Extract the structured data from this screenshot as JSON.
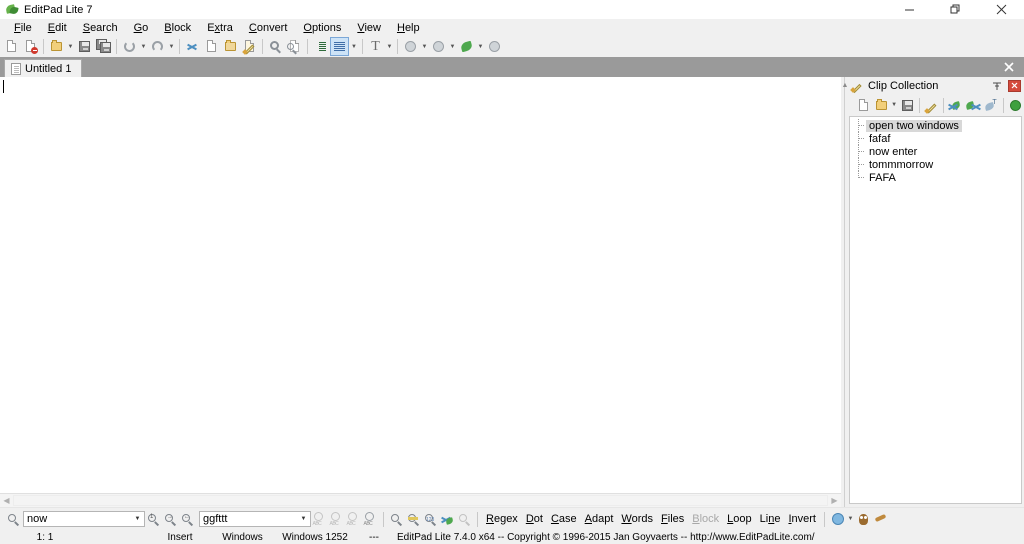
{
  "window": {
    "title": "EditPad Lite 7",
    "app_icon": "leaf-icon",
    "controls": {
      "minimize": "–",
      "restore": "❐",
      "close": "✕"
    }
  },
  "menu": {
    "items": [
      {
        "label": "File",
        "accel": "F"
      },
      {
        "label": "Edit",
        "accel": "E"
      },
      {
        "label": "Search",
        "accel": "S"
      },
      {
        "label": "Go",
        "accel": "G"
      },
      {
        "label": "Block",
        "accel": "B"
      },
      {
        "label": "Extra",
        "accel": "x"
      },
      {
        "label": "Convert",
        "accel": "C"
      },
      {
        "label": "Options",
        "accel": "O"
      },
      {
        "label": "View",
        "accel": "V"
      },
      {
        "label": "Help",
        "accel": "H"
      }
    ]
  },
  "toolbar": {
    "buttons": [
      {
        "name": "new-file-icon",
        "title": "New"
      },
      {
        "name": "close-file-icon",
        "title": "Close"
      },
      {
        "name": "open-file-icon",
        "title": "Open"
      },
      {
        "name": "save-file-icon",
        "title": "Save"
      },
      {
        "name": "save-all-icon",
        "title": "Save All"
      },
      {
        "name": "undo-icon",
        "title": "Undo"
      },
      {
        "name": "redo-icon",
        "title": "Redo"
      },
      {
        "name": "cut-icon",
        "title": "Cut"
      },
      {
        "name": "copy-icon",
        "title": "Copy"
      },
      {
        "name": "paste-icon",
        "title": "Paste"
      },
      {
        "name": "edit-clip-icon",
        "title": "Edit Clip"
      },
      {
        "name": "find-icon",
        "title": "Find"
      },
      {
        "name": "find-replace-icon",
        "title": "Replace"
      },
      {
        "name": "indent-icon",
        "title": "Indent"
      },
      {
        "name": "word-wrap-icon",
        "title": "Word Wrap"
      },
      {
        "name": "font-icon",
        "title": "Font"
      },
      {
        "name": "back-icon",
        "title": "Back"
      },
      {
        "name": "forward-icon",
        "title": "Forward"
      },
      {
        "name": "leaf-icon",
        "title": "Clip Collection"
      },
      {
        "name": "globe-icon",
        "title": "Browse"
      }
    ]
  },
  "tabs": {
    "items": [
      {
        "label": "Untitled 1",
        "icon": "document-icon",
        "active": true
      }
    ],
    "close_label": "✕"
  },
  "editor": {
    "content": "",
    "caret_visible": true
  },
  "clip_panel": {
    "title": "Clip Collection",
    "icon": "clip-pencil-icon",
    "pin_label": "⚲",
    "close_label": "✕",
    "toolbar": [
      {
        "name": "new-clip-icon",
        "title": "New Clip"
      },
      {
        "name": "open-collection-icon",
        "title": "Open Collection"
      },
      {
        "name": "save-collection-icon",
        "title": "Save Collection"
      },
      {
        "name": "edit-clip-icon",
        "title": "Edit Clip"
      },
      {
        "name": "cut-clip-icon",
        "title": "Cut Clip"
      },
      {
        "name": "paste-clip-icon",
        "title": "Paste Clip"
      },
      {
        "name": "insert-clip-icon",
        "title": "Insert Clip"
      },
      {
        "name": "globe-green-icon",
        "title": "Go"
      }
    ],
    "items": [
      {
        "label": "open two windows",
        "selected": true
      },
      {
        "label": "fafaf",
        "selected": false
      },
      {
        "label": "now enter",
        "selected": false
      },
      {
        "label": "tommmorrow",
        "selected": false
      },
      {
        "label": "FAFA",
        "selected": false
      }
    ]
  },
  "search_bar": {
    "search_icon": "search-icon",
    "find_value": "now",
    "find_placeholder": "",
    "replace_value": "ggfttt",
    "replace_placeholder": "",
    "dropdown_glyph": "▼",
    "find_buttons": [
      {
        "name": "find-first-icon",
        "title": "Find First"
      },
      {
        "name": "find-next-icon",
        "title": "Find Next"
      },
      {
        "name": "find-previous-icon",
        "title": "Find Previous"
      }
    ],
    "replace_buttons": [
      {
        "name": "replace-first-icon",
        "title": "Replace First"
      },
      {
        "name": "replace-next-icon",
        "title": "Replace Next"
      },
      {
        "name": "replace-previous-icon",
        "title": "Replace Previous"
      },
      {
        "name": "replace-all-icon",
        "title": "Replace All"
      }
    ],
    "count_buttons": [
      {
        "name": "count-matches-icon",
        "title": "Count Matches"
      },
      {
        "name": "highlight-matches-icon",
        "title": "Highlight Matches"
      },
      {
        "name": "number-matches-icon",
        "title": "Number Matches"
      },
      {
        "name": "cut-matches-icon",
        "title": "Cut Matches"
      },
      {
        "name": "select-matches-icon",
        "title": "Select Matches"
      }
    ],
    "options": [
      {
        "label": "Regex",
        "accel": "R",
        "enabled": true
      },
      {
        "label": "Dot",
        "accel": "D",
        "enabled": true
      },
      {
        "label": "Case",
        "accel": "C",
        "enabled": true
      },
      {
        "label": "Adapt",
        "accel": "A",
        "enabled": true
      },
      {
        "label": "Words",
        "accel": "W",
        "enabled": true
      },
      {
        "label": "Files",
        "accel": "F",
        "enabled": true
      },
      {
        "label": "Block",
        "accel": "B",
        "enabled": false
      },
      {
        "label": "Loop",
        "accel": "L",
        "enabled": true
      },
      {
        "label": "Line",
        "accel": "n",
        "enabled": true
      },
      {
        "label": "Invert",
        "accel": "I",
        "enabled": true
      }
    ],
    "trailing_buttons": [
      {
        "name": "search-web-icon",
        "title": "Search Web"
      },
      {
        "name": "owl-icon",
        "title": "RegexBuddy"
      },
      {
        "name": "magic-wand-icon",
        "title": "RegexMagic"
      }
    ]
  },
  "status_bar": {
    "cursor_position": "1: 1",
    "selection": "",
    "insert_mode": "Insert",
    "line_break": "Windows",
    "encoding": "Windows 1252",
    "separator": "---",
    "copyright": "EditPad Lite 7.4.0 x64  --  Copyright © 1996-2015  Jan Goyvaerts  --  http://www.EditPadLite.com/"
  },
  "colors": {
    "window_bg": "#f0f0f0",
    "tabbar_bg": "#9a9a9a",
    "editor_bg": "#ffffff",
    "selection_bg": "#d8d8d8",
    "close_red": "#d44a3c",
    "accent_blue": "#cde3f7"
  }
}
